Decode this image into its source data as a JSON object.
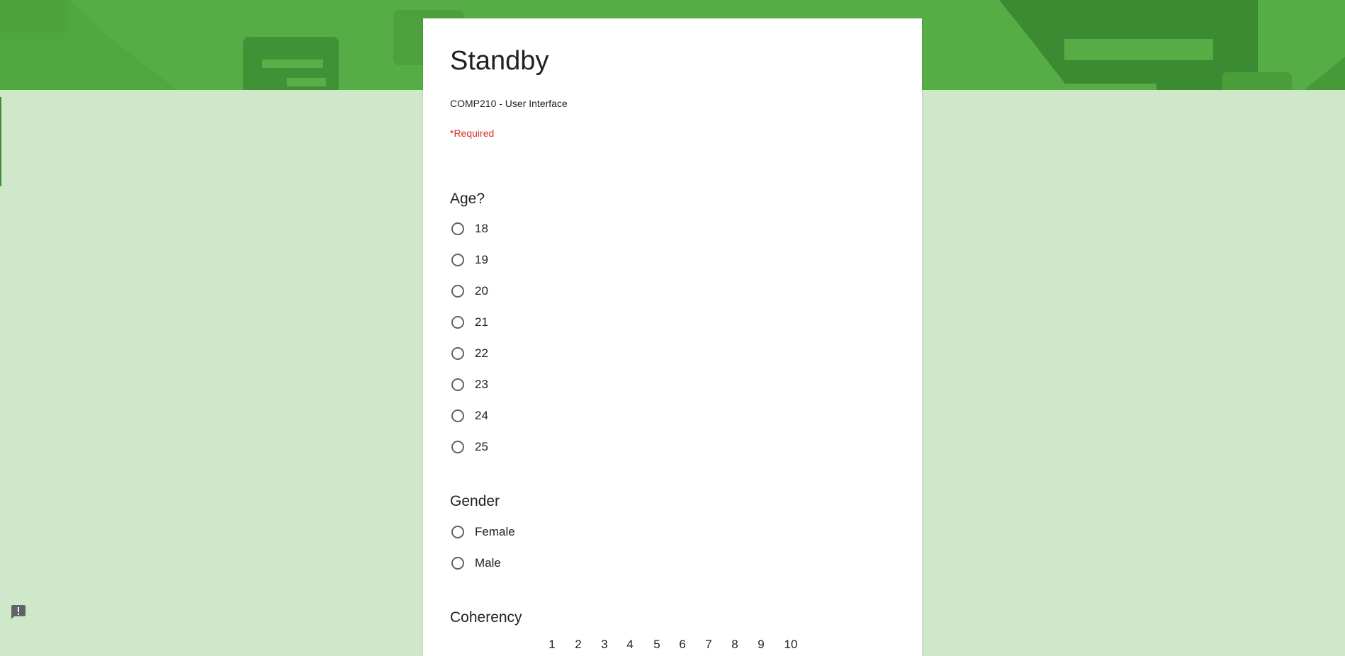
{
  "form": {
    "title": "Standby",
    "description": "COMP210 - User Interface",
    "required_note": "*Required"
  },
  "questions": [
    {
      "title": "Age?",
      "options": [
        "18",
        "19",
        "20",
        "21",
        "22",
        "23",
        "24",
        "25"
      ]
    },
    {
      "title": "Gender",
      "options": [
        "Female",
        "Male"
      ]
    },
    {
      "title": "Coherency",
      "scale": [
        "1",
        "2",
        "3",
        "4",
        "5",
        "6",
        "7",
        "8",
        "9",
        "10"
      ]
    }
  ],
  "icons": {
    "radio": "radio-unchecked-icon",
    "feedback": "report-feedback-icon"
  },
  "colors": {
    "banner": "#57ad45",
    "page_background": "#cfe8c9",
    "required": "#d93025",
    "card": "#ffffff"
  }
}
